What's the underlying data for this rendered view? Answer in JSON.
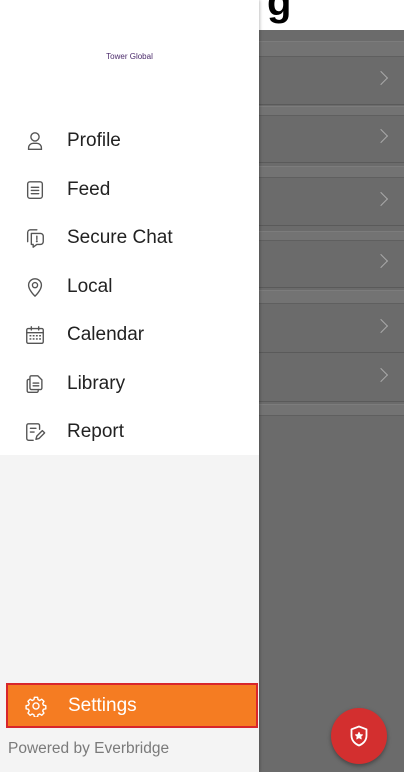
{
  "background": {
    "heading_fragment": "g",
    "rows": 6
  },
  "drawer": {
    "org_name": "Tower Global",
    "menu": [
      {
        "label": "Profile",
        "icon": "person-icon"
      },
      {
        "label": "Feed",
        "icon": "feed-icon"
      },
      {
        "label": "Secure Chat",
        "icon": "secure-chat-icon"
      },
      {
        "label": "Local",
        "icon": "location-pin-icon"
      },
      {
        "label": "Calendar",
        "icon": "calendar-icon"
      },
      {
        "label": "Library",
        "icon": "library-icon"
      },
      {
        "label": "Report",
        "icon": "report-icon"
      }
    ],
    "settings": {
      "label": "Settings",
      "icon": "gear-icon"
    },
    "footer": "Powered by Everbridge"
  },
  "fab": {
    "icon": "shield-star-icon",
    "color": "#d32f2f"
  },
  "colors": {
    "accent": "#f57c22",
    "highlight_border": "#d8262b",
    "org_name": "#4b2a6b",
    "scrim": "#6b6b6b"
  }
}
